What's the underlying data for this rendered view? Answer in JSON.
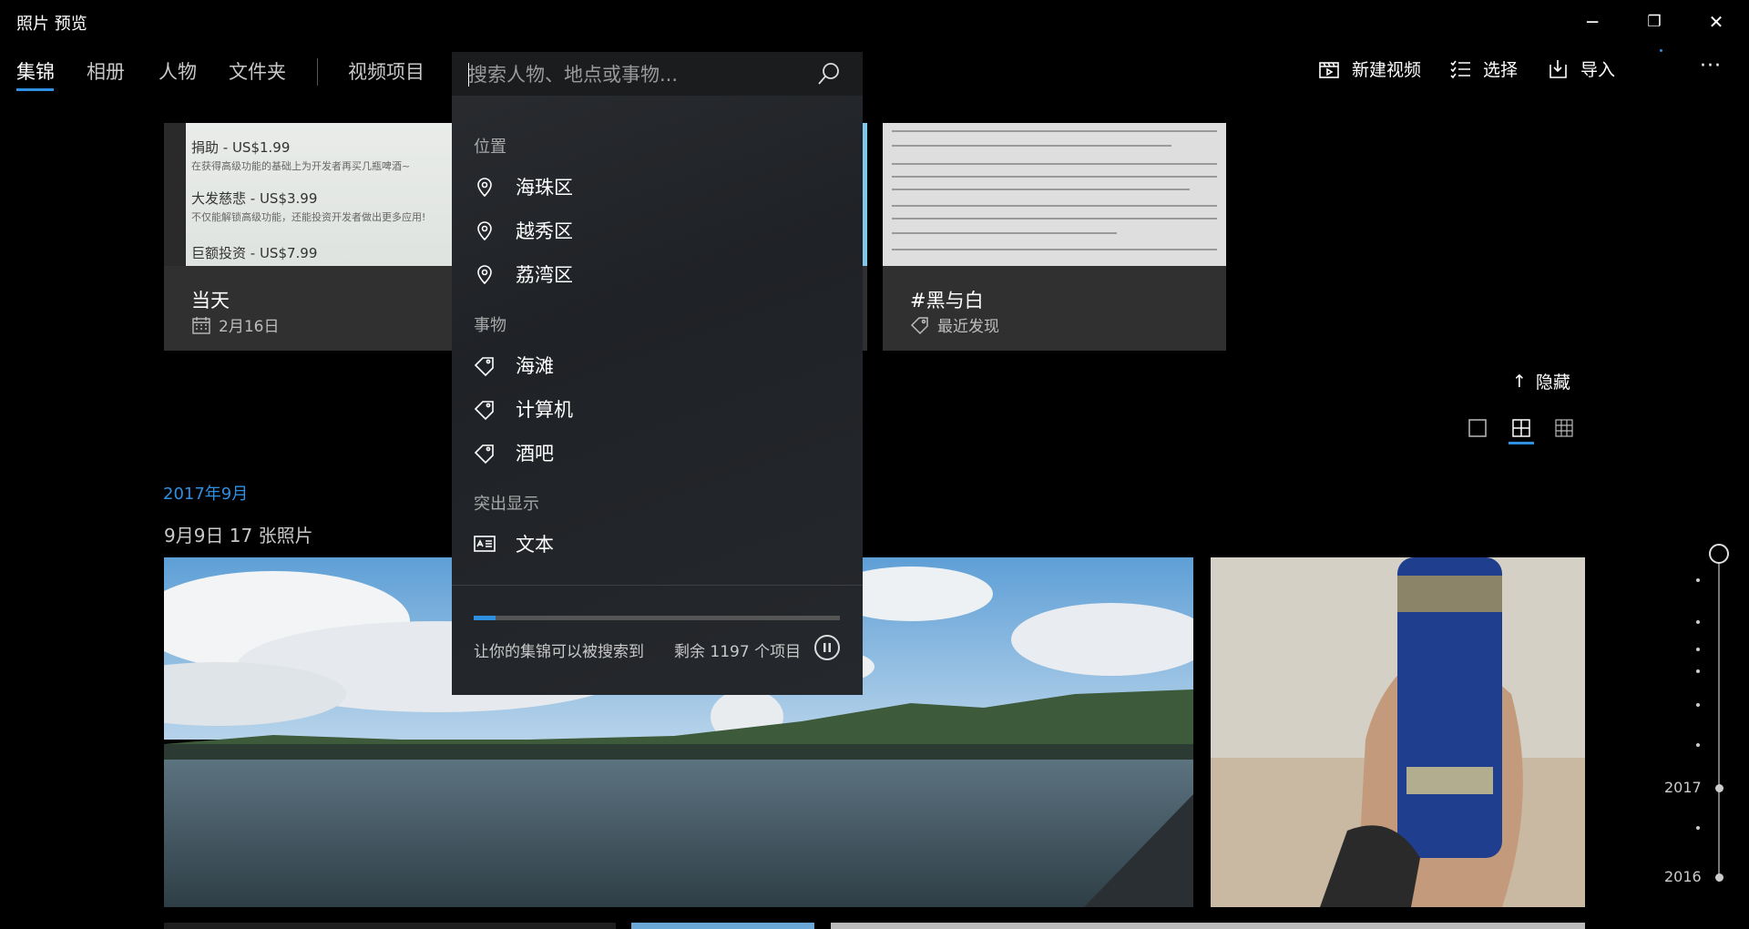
{
  "window": {
    "title": "照片 预览",
    "minimize_glyph": "─",
    "restore_glyph": "❐",
    "close_glyph": "✕"
  },
  "nav": {
    "tabs": [
      {
        "label": "集锦",
        "active": true
      },
      {
        "label": "相册",
        "active": false
      },
      {
        "label": "人物",
        "active": false
      },
      {
        "label": "文件夹",
        "active": false
      },
      {
        "label": "视频项目",
        "active": false
      }
    ]
  },
  "commands": {
    "new_video": "新建视频",
    "select": "选择",
    "import": "导入",
    "more": "···"
  },
  "search": {
    "placeholder": "搜索人物、地点或事物...",
    "value": "",
    "sections": [
      {
        "title": "位置",
        "icon": "location-pin-icon",
        "items": [
          "海珠区",
          "越秀区",
          "荔湾区"
        ]
      },
      {
        "title": "事物",
        "icon": "tag-icon",
        "items": [
          "海滩",
          "计算机",
          "酒吧"
        ]
      },
      {
        "title": "突出显示",
        "icon": "text-card-icon",
        "items": [
          "文本"
        ]
      }
    ],
    "indexing": {
      "status": "让你的集锦可以被搜索到",
      "remaining": "剩余 1197 个项目",
      "progress": 0.06
    }
  },
  "cards": [
    {
      "title": "当天",
      "subtitle": "2月16日",
      "subtitle_icon": "calendar-icon",
      "rows": [
        {
          "text": "捐助 - US$1.99",
          "note": "在获得高级功能的基础上为开发者再买几瓶啤酒~"
        },
        {
          "text": "大发慈悲 - US$3.99",
          "note": "不仅能解锁高级功能，还能投资开发者做出更多应用!"
        },
        {
          "text": "巨额投资 - US$7.99",
          "note": ""
        }
      ]
    },
    {
      "title": "#黑与白",
      "subtitle": "最近发现",
      "subtitle_icon": "tag-icon"
    }
  ],
  "hide_label": "隐藏",
  "view_modes": [
    "single-view-icon",
    "medium-grid-icon",
    "small-grid-icon"
  ],
  "selected_view": 1,
  "month_heading": "2017年9月",
  "day_heading": "9月9日   17 张照片",
  "timeline": {
    "years": [
      "2017",
      "2016"
    ]
  },
  "colors": {
    "accent": "#2f8fe0",
    "panel": "#1f2226",
    "background": "#000000"
  }
}
